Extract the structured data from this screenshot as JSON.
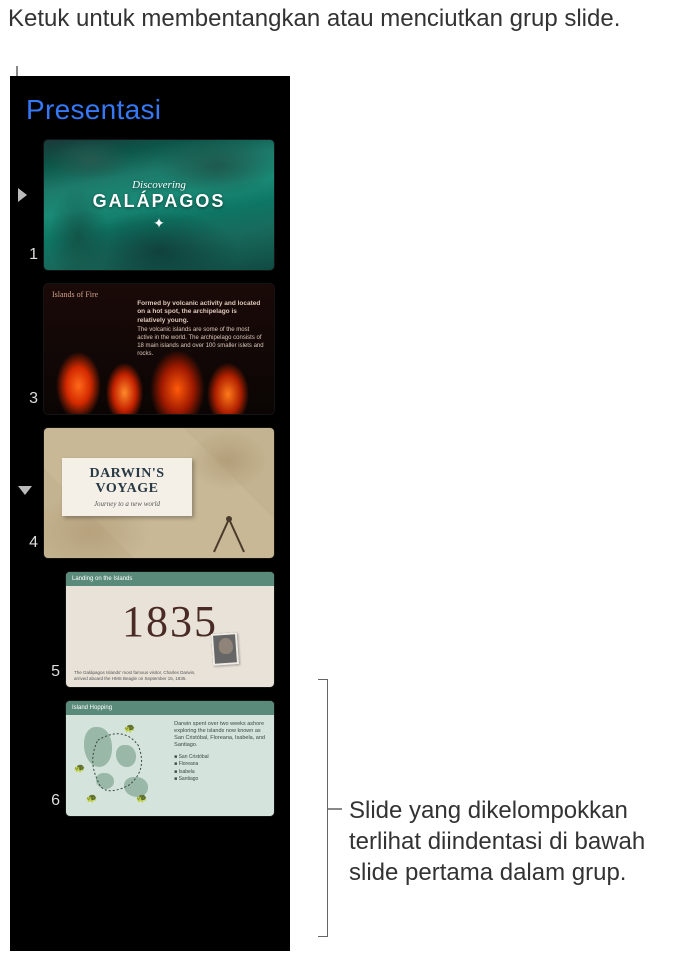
{
  "annotations": {
    "top": "Ketuk untuk membentangkan atau menciutkan grup slide.",
    "right": "Slide yang dikelompokkan terlihat diindentasi di bawah slide pertama dalam grup."
  },
  "panel": {
    "title": "Presentasi"
  },
  "slides": [
    {
      "number": "1",
      "disclosure": "right",
      "content": {
        "subtitle": "Discovering",
        "title": "GALÁPAGOS"
      }
    },
    {
      "number": "3",
      "header": "Islands of Fire",
      "text_bold": "Formed by volcanic activity and located on a hot spot, the archipelago is relatively young.",
      "text_body": "The volcanic islands are some of the most active in the world. The archipelago consists of 18 main islands and over 100 smaller islets and rocks."
    },
    {
      "number": "4",
      "disclosure": "down",
      "content": {
        "title": "DARWIN'S VOYAGE",
        "subtitle": "Journey to a new world"
      }
    },
    {
      "number": "5",
      "indented": true,
      "header": "Landing on the Islands",
      "year": "1835",
      "caption": "The Galápagos Islands' most famous visitor, Charles Darwin, arrived aboard the HMS Beagle on September 15, 1835."
    },
    {
      "number": "6",
      "indented": true,
      "header": "Island Hopping",
      "lead": "Darwin spent over two weeks ashore exploring the islands now known as San Cristóbal, Floreana, Isabela, and Santiago.",
      "items": [
        "San Cristóbal",
        "Floreana",
        "Isabela",
        "Santiago"
      ]
    }
  ]
}
